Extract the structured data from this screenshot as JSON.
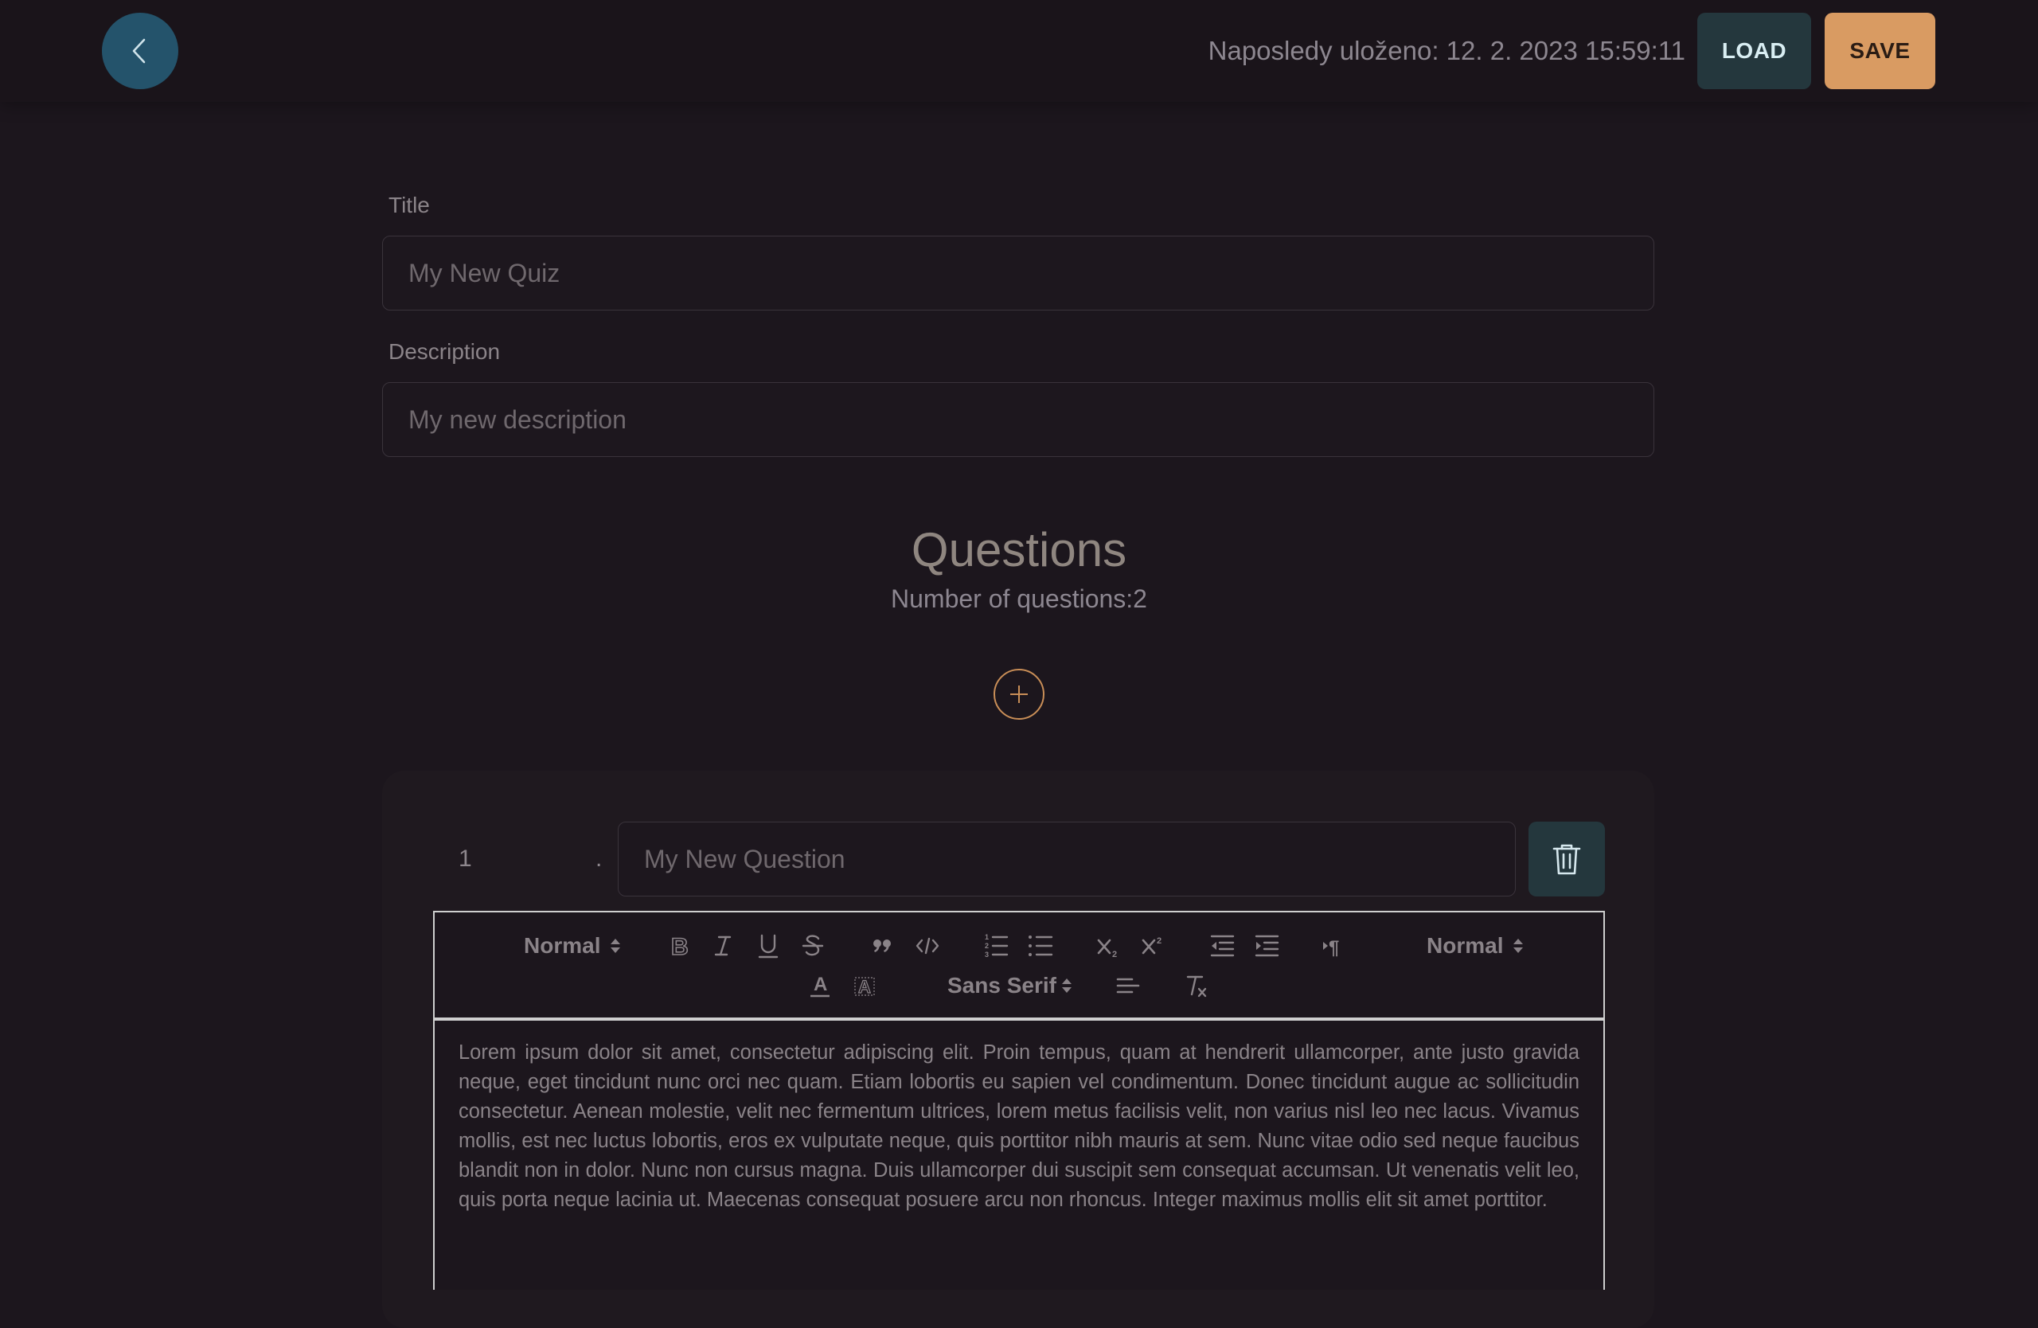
{
  "header": {
    "back_icon": "chevron-left-icon",
    "saved_status": "Naposledy uloženo: 12. 2. 2023 15:59:11",
    "load_label": "LOAD",
    "save_label": "SAVE",
    "colors": {
      "back": "#24536b",
      "load": "#24373d",
      "save": "#d99b62"
    }
  },
  "form": {
    "title_label": "Title",
    "title_placeholder": "My New Quiz",
    "description_label": "Description",
    "description_placeholder": "My new description"
  },
  "questions": {
    "heading": "Questions",
    "count_text": "Number of questions:2",
    "add_icon": "plus-circle-icon",
    "items": [
      {
        "number": "1",
        "separator": ".",
        "placeholder": "My New Question",
        "delete_icon": "trash-icon",
        "toolbar": {
          "header_picker": "Normal",
          "size_picker": "Normal",
          "font_picker": "Sans Serif",
          "buttons": [
            "bold-icon",
            "italic-icon",
            "underline-icon",
            "strike-icon",
            "blockquote-icon",
            "code-block-icon",
            "ordered-list-icon",
            "bullet-list-icon",
            "subscript-icon",
            "superscript-icon",
            "outdent-icon",
            "indent-icon",
            "rtl-direction-icon",
            "text-color-icon",
            "background-color-icon",
            "align-icon",
            "clear-format-icon"
          ]
        },
        "content": "Lorem ipsum dolor sit amet, consectetur adipiscing elit. Proin tempus, quam at hendrerit ullamcorper, ante justo gravida neque, eget tincidunt nunc orci nec quam. Etiam lobortis eu sapien vel condimentum. Donec tincidunt augue ac sollicitudin consectetur. Aenean molestie, velit nec fermentum ultrices, lorem metus facilisis velit, non varius nisl leo nec lacus. Vivamus mollis, est nec luctus lobortis, eros ex vulputate neque, quis porttitor nibh mauris at sem. Nunc vitae odio sed neque faucibus blandit non in dolor. Nunc non cursus magna. Duis ullamcorper dui suscipit sem consequat accumsan. Ut venenatis velit leo, quis porta neque lacinia ut. Maecenas consequat posuere arcu non rhoncus. Integer maximus mollis elit sit amet porttitor."
      }
    ]
  }
}
